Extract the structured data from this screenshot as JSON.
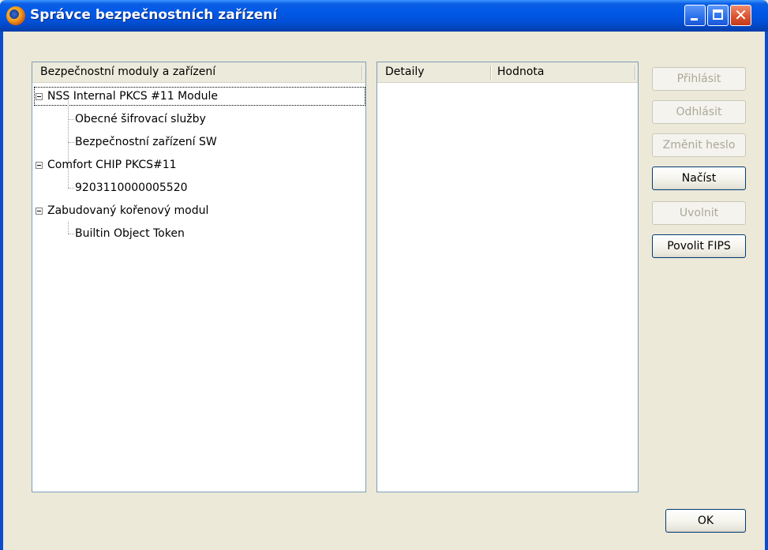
{
  "window": {
    "title": "Správce bezpečnostních zařízení",
    "controls": {
      "minimize": "minimize",
      "maximize": "maximize",
      "close": "✕"
    }
  },
  "left_panel": {
    "header": "Bezpečnostní moduly a zařízení",
    "tree": [
      {
        "label": "NSS Internal PKCS #11 Module",
        "expanded": true,
        "children": [
          {
            "label": "Obecné šifrovací služby"
          },
          {
            "label": "Bezpečnostní zařízení SW"
          }
        ]
      },
      {
        "label": "Comfort CHIP PKCS#11",
        "expanded": true,
        "children": [
          {
            "label": "9203110000005520"
          }
        ]
      },
      {
        "label": "Zabudovaný kořenový modul",
        "expanded": true,
        "children": [
          {
            "label": "Builtin Object Token"
          }
        ]
      }
    ]
  },
  "right_panel": {
    "columns": [
      "Detaily",
      "Hodnota"
    ]
  },
  "buttons": {
    "login": {
      "label": "Přihlásit",
      "enabled": false
    },
    "logout": {
      "label": "Odhlásit",
      "enabled": false
    },
    "change_password": {
      "label": "Změnit heslo",
      "enabled": false
    },
    "load": {
      "label": "Načíst",
      "enabled": true
    },
    "unload": {
      "label": "Uvolnit",
      "enabled": false
    },
    "enable_fips": {
      "label": "Povolit FIPS",
      "enabled": true
    },
    "ok": {
      "label": "OK",
      "enabled": true
    }
  },
  "colors": {
    "titlebar": "#0058E6",
    "face": "#ECE9D8",
    "border": "#7F9DB9",
    "disabled_text": "#ACA899"
  },
  "icons": {
    "app": "firefox-icon",
    "expander": "minus-box-icon"
  }
}
